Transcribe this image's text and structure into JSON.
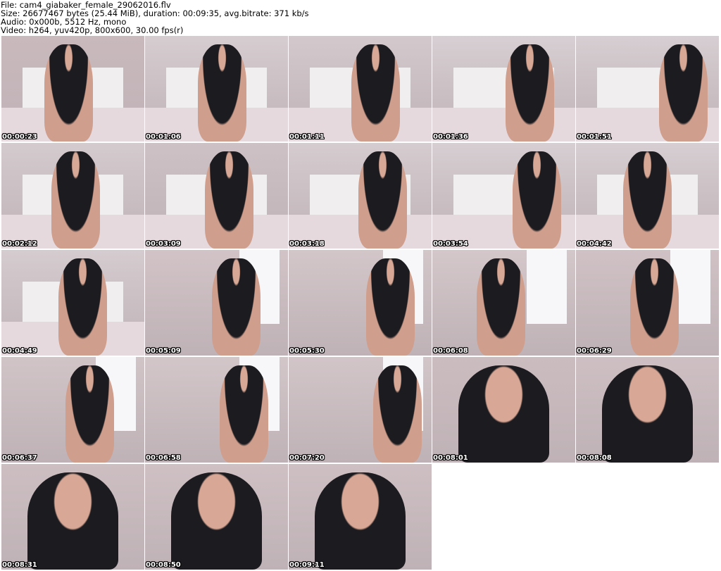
{
  "header": {
    "lines": [
      "File: cam4_giabaker_female_29062016.flv",
      "Size: 26677467 bytes (25.44 MiB), duration: 00:09:35, avg.bitrate: 371 kb/s",
      "Audio: 0x000b, 5512 Hz, mono",
      "Video: h264, yuv420p, 800x600, 30.00 fps(r)"
    ]
  },
  "thumbnails": [
    {
      "timestamp": "00:00:23",
      "scene": "bedroom",
      "tone": "#c9b9bd"
    },
    {
      "timestamp": "00:01:06",
      "scene": "bedroom",
      "tone": "#d6cdd1"
    },
    {
      "timestamp": "00:01:11",
      "scene": "bedroom",
      "tone": "#d3c9cd"
    },
    {
      "timestamp": "00:01:36",
      "scene": "bedroom",
      "tone": "#d7cfd3"
    },
    {
      "timestamp": "00:01:51",
      "scene": "bedroom",
      "tone": "#d6ced2"
    },
    {
      "timestamp": "00:02:12",
      "scene": "bedroom",
      "tone": "#d4cbcf"
    },
    {
      "timestamp": "00:03:09",
      "scene": "bedroom",
      "tone": "#cdc1c5"
    },
    {
      "timestamp": "00:03:18",
      "scene": "bedroom",
      "tone": "#d5ccd0"
    },
    {
      "timestamp": "00:03:54",
      "scene": "bedroom",
      "tone": "#d6ced2"
    },
    {
      "timestamp": "00:04:42",
      "scene": "bedroom",
      "tone": "#d6ced2"
    },
    {
      "timestamp": "00:04:49",
      "scene": "bedroom",
      "tone": "#d5ccd0"
    },
    {
      "timestamp": "00:05:09",
      "scene": "window",
      "tone": "#d1c3c6"
    },
    {
      "timestamp": "00:05:30",
      "scene": "window",
      "tone": "#d3c6c9"
    },
    {
      "timestamp": "00:06:08",
      "scene": "window",
      "tone": "#d4c7ca"
    },
    {
      "timestamp": "00:06:29",
      "scene": "window",
      "tone": "#cfc1c4"
    },
    {
      "timestamp": "00:06:37",
      "scene": "window",
      "tone": "#d1c4c7"
    },
    {
      "timestamp": "00:06:58",
      "scene": "window",
      "tone": "#d3c6c9"
    },
    {
      "timestamp": "00:07:20",
      "scene": "window",
      "tone": "#d2c5c8"
    },
    {
      "timestamp": "00:08:01",
      "scene": "closeup",
      "tone": "#cbbcbf"
    },
    {
      "timestamp": "00:08:08",
      "scene": "closeup",
      "tone": "#cdbfc2"
    },
    {
      "timestamp": "00:08:31",
      "scene": "closeup",
      "tone": "#ccbec1"
    },
    {
      "timestamp": "00:08:50",
      "scene": "closeup",
      "tone": "#cec0c3"
    },
    {
      "timestamp": "00:09:11",
      "scene": "closeup",
      "tone": "#cdbfc2"
    }
  ]
}
